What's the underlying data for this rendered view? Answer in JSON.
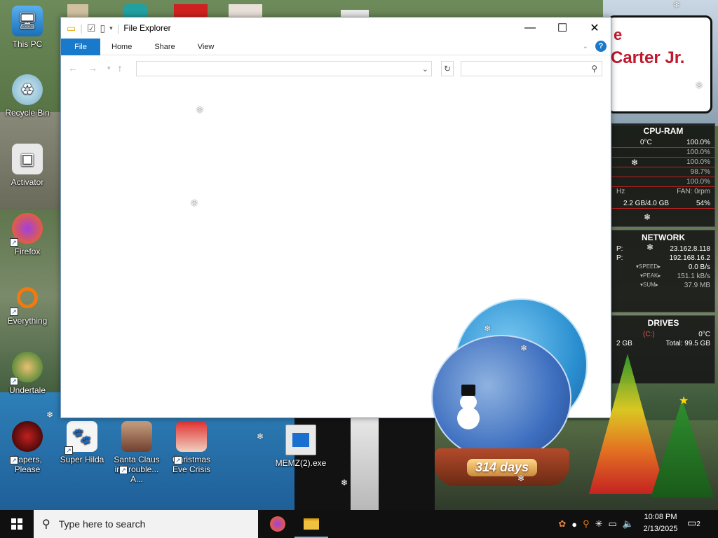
{
  "desktop_icons": [
    {
      "label": "This PC"
    },
    {
      "label": "Recycle Bin"
    },
    {
      "label": "Activator"
    },
    {
      "label": "Firefox"
    },
    {
      "label": "Everything"
    },
    {
      "label": "Undertale"
    },
    {
      "label": "Papers, Please"
    },
    {
      "label": "Super Hilda"
    },
    {
      "label": "Santa Claus in Trouble... A..."
    },
    {
      "label": "Christmas Eve Crisis"
    },
    {
      "label": "MEMZ(2).exe"
    }
  ],
  "explorer": {
    "title": "File Explorer",
    "tabs": {
      "file": "File",
      "home": "Home",
      "share": "Share",
      "view": "View"
    },
    "help": "?"
  },
  "banner": {
    "line1": "e",
    "line2": "Carter Jr."
  },
  "cpu_ram": {
    "title": "CPU-RAM",
    "temp": "0°C",
    "total": "100.0%",
    "cores": [
      "100.0%",
      "100.0%",
      "98.7%",
      "100.0%"
    ],
    "freq": "Hz",
    "fan": "FAN: 0rpm",
    "ram": "2.2 GB/4.0 GB",
    "ram_pct": "54%"
  },
  "network": {
    "title": "NETWORK",
    "ip_label_1": "P:",
    "ip1": "23.162.8.118",
    "ip_label_2": "P:",
    "ip2": "192.168.16.2",
    "speed_label": "SPEED",
    "speed": "0.0 B/s",
    "peak_label": "PEAK",
    "peak": "151.1 kB/s",
    "sum_label": "SUM",
    "sum": "37.9 MB"
  },
  "drives": {
    "title": "DRIVES",
    "drive": "(C:)",
    "temp": "0°C",
    "used": "2 GB",
    "total": "Total: 99.5 GB"
  },
  "globe": {
    "counter": "314 days"
  },
  "taskbar": {
    "search_placeholder": "Type here to search",
    "time": "10:08 PM",
    "date": "2/13/2025",
    "notifications": "2"
  }
}
